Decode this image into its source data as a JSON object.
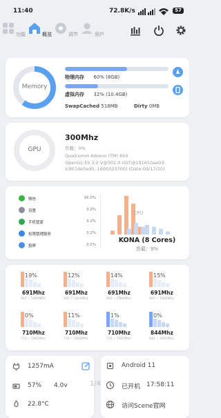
{
  "status_bar": {
    "time": "11:40",
    "network_speed": "72.8K/s",
    "battery_level": "57"
  },
  "nav": {
    "tabs": [
      {
        "label": "功能"
      },
      {
        "label": "概览"
      },
      {
        "label": "调节"
      },
      {
        "label": "用户"
      }
    ],
    "active_tab": "概览",
    "actions": [
      "chart-icon",
      "power-icon",
      "gear-icon"
    ]
  },
  "memory": {
    "label": "Memory",
    "ring_used_fraction": 0.6,
    "physical_label": "物理内存",
    "physical_value": "60% (8GB)",
    "physical_fraction": 0.6,
    "virtual_label": "虚拟内存",
    "virtual_value": "32% (10.4GB)",
    "virtual_fraction": 0.32,
    "swapcached": "SwapCached",
    "swapcached_value": "518MB",
    "dirty": "Dirty",
    "dirty_value": "0MB"
  },
  "gpu": {
    "label": "GPU",
    "freq": "300Mhz",
    "load": "负载：0%",
    "renderer": "Qualcomm Adreno (TM) 650",
    "version_line1": "OpenGL ES 3.2 V@502.0 (GIT@191610ae03,",
    "version_line2": "Ic907de5ed0, 1600323700) (Date:09/17/20)"
  },
  "apps": [
    {
      "name": "微信",
      "percent": "16.0%",
      "color": "#3cb34a"
    },
    {
      "name": "设置",
      "percent": "3.2%",
      "color": "#8a8f98"
    },
    {
      "name": "手机管家",
      "percent": "3.2%",
      "color": "#2fa84f"
    },
    {
      "name": "权限管理服务",
      "percent": "3.2%",
      "color": "#3d87e6"
    },
    {
      "name": "投屏",
      "percent": "3.2%",
      "color": "#4a8ee8"
    }
  ],
  "cpu": {
    "label": "CPU",
    "chip": "KONA (8 Cores)",
    "load": "负载：9%",
    "history": [
      {
        "bars": [
          {
            "v": 0.1,
            "c": "#f4b08a"
          }
        ]
      },
      {
        "bars": [
          {
            "v": 0.5,
            "c": "#f4b08a"
          }
        ]
      },
      {
        "bars": [
          {
            "v": 1.0,
            "c": "#f4b08a"
          },
          {
            "v": 0.15,
            "c": "#c6d8f2"
          }
        ]
      },
      {
        "bars": [
          {
            "v": 0.8,
            "c": "#f4b08a"
          },
          {
            "v": 0.3,
            "c": "#c6d8f2"
          }
        ]
      },
      {
        "bars": [
          {
            "v": 0.2,
            "c": "#f4b08a"
          },
          {
            "v": 0.2,
            "c": "#c6d8f2"
          }
        ]
      },
      {
        "bars": [
          {
            "v": 0.25,
            "c": "#c6d8f2"
          }
        ]
      },
      {
        "bars": [
          {
            "v": 0.2,
            "c": "#c6d8f2"
          }
        ]
      },
      {
        "bars": [
          {
            "v": 0.15,
            "c": "#c6d8f2"
          }
        ]
      },
      {
        "bars": [
          {
            "v": 0.08,
            "c": "#c6d8f2"
          }
        ]
      }
    ]
  },
  "cores": [
    {
      "percent": "19%",
      "freq": "691Mhz",
      "range": "691 ~ 1804Mhz",
      "color": "#f4b08a"
    },
    {
      "percent": "12%",
      "freq": "691Mhz",
      "range": "691 ~ 1804Mhz",
      "color": "#f4b08a"
    },
    {
      "percent": "14%",
      "freq": "691Mhz",
      "range": "691 ~ 1804Mhz",
      "color": "#f4b08a"
    },
    {
      "percent": "15%",
      "freq": "691Mhz",
      "range": "691 ~ 1804Mhz",
      "color": "#f4b08a"
    },
    {
      "percent": "0%",
      "freq": "710Mhz",
      "range": "710 ~ 1862Mhz",
      "color": "#f4b08a"
    },
    {
      "percent": "11%",
      "freq": "710Mhz",
      "range": "710 ~ 1862Mhz",
      "color": "#f4b08a"
    },
    {
      "percent": "1%",
      "freq": "710Mhz",
      "range": "710 ~ 1862Mhz",
      "color": "#7aa6f2"
    },
    {
      "percent": "0%",
      "freq": "844Mhz",
      "range": "844 ~ 3091Mhz",
      "color": "#7aa6f2"
    }
  ],
  "battery_card": {
    "current": "1257mA",
    "level": "57%",
    "voltage": "4.0v",
    "temperature": "22.8°C"
  },
  "system_card": {
    "android": "Android 11",
    "uptime_label": "已开机",
    "uptime": "17:58:11",
    "website": "访问Scene官网"
  },
  "page_indicator": "1/4",
  "colors": {
    "accent": "#5aa0f0",
    "ring_track": "#e3e6ec",
    "cpu_orange": "#f4b08a",
    "cpu_blue": "#7aa6f2"
  }
}
